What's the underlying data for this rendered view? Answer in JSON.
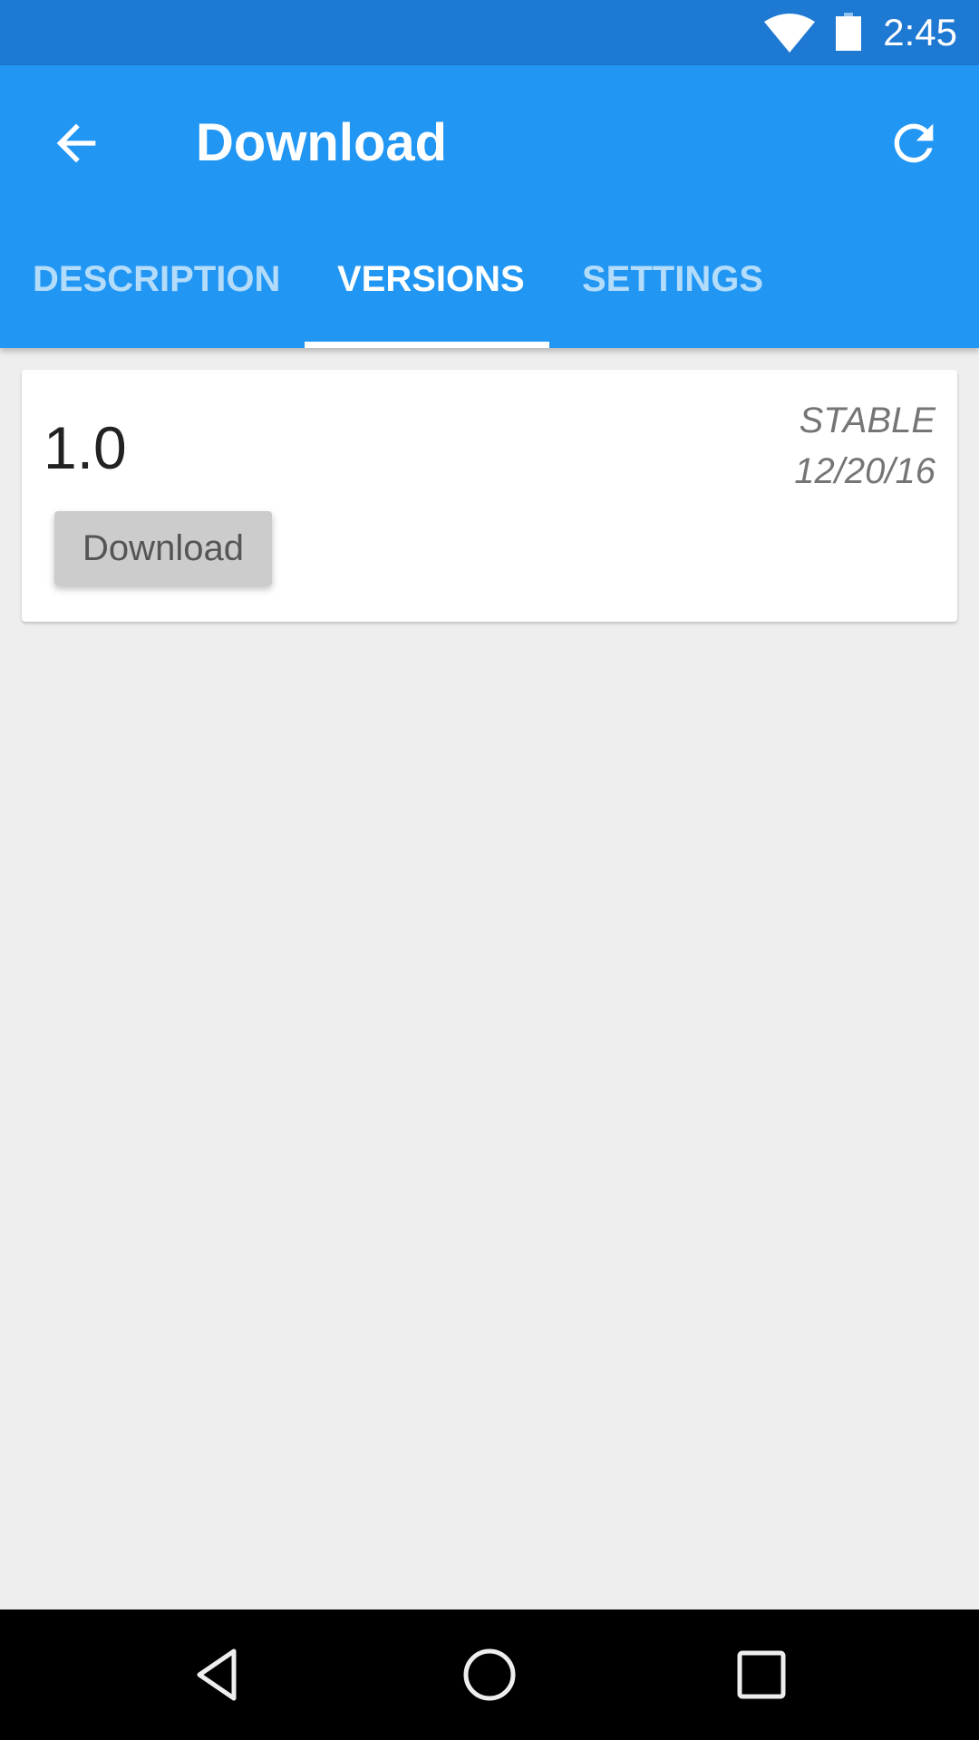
{
  "status_bar": {
    "time": "2:45",
    "icons": [
      "wifi-icon",
      "battery-icon"
    ]
  },
  "app_bar": {
    "title": "Download",
    "back_icon": "arrow-back-icon",
    "refresh_icon": "refresh-icon",
    "colors": {
      "primary": "#2196f3",
      "primary_dark": "#1e79d3"
    }
  },
  "tabs": [
    {
      "label": "DESCRIPTION",
      "active": false
    },
    {
      "label": "VERSIONS",
      "active": true
    },
    {
      "label": "SETTINGS",
      "active": false
    }
  ],
  "versions": [
    {
      "version": "1.0",
      "channel": "STABLE",
      "date": "12/20/16",
      "button_label": "Download"
    }
  ],
  "nav_bar": {
    "icons": [
      "nav-back-icon",
      "nav-home-icon",
      "nav-recents-icon"
    ]
  }
}
